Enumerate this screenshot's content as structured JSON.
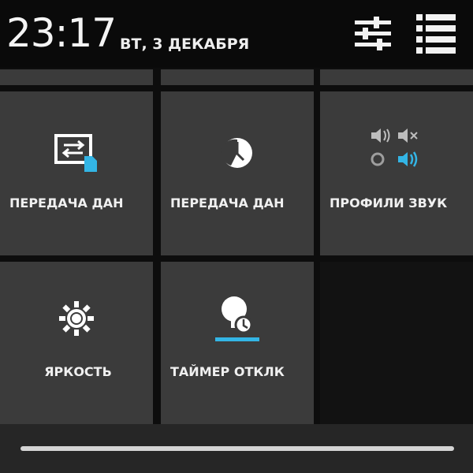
{
  "status": {
    "time": "23:17",
    "date": "ВТ, 3 ДЕКАБРЯ"
  },
  "header_icons": {
    "settings": "settings-sliders-icon",
    "list": "list-view-icon"
  },
  "tiles": [
    {
      "label": "ПЕРЕДАЧА ДАН",
      "icon": "data-transfer-icon"
    },
    {
      "label": "ПЕРЕДАЧА ДАН",
      "icon": "clock-data-icon"
    },
    {
      "label": "ПРОФИЛИ ЗВУК",
      "icon": "sound-profiles-icon"
    },
    {
      "label": "ЯРКОСТЬ",
      "icon": "brightness-icon"
    },
    {
      "label": "ТАЙМЕР ОТКЛК",
      "icon": "sleep-timer-icon"
    }
  ],
  "colors": {
    "tile": "#3b3b3b",
    "background": "#0d0d0d",
    "accent": "#33b5e5",
    "text": "#f0f0f0"
  }
}
